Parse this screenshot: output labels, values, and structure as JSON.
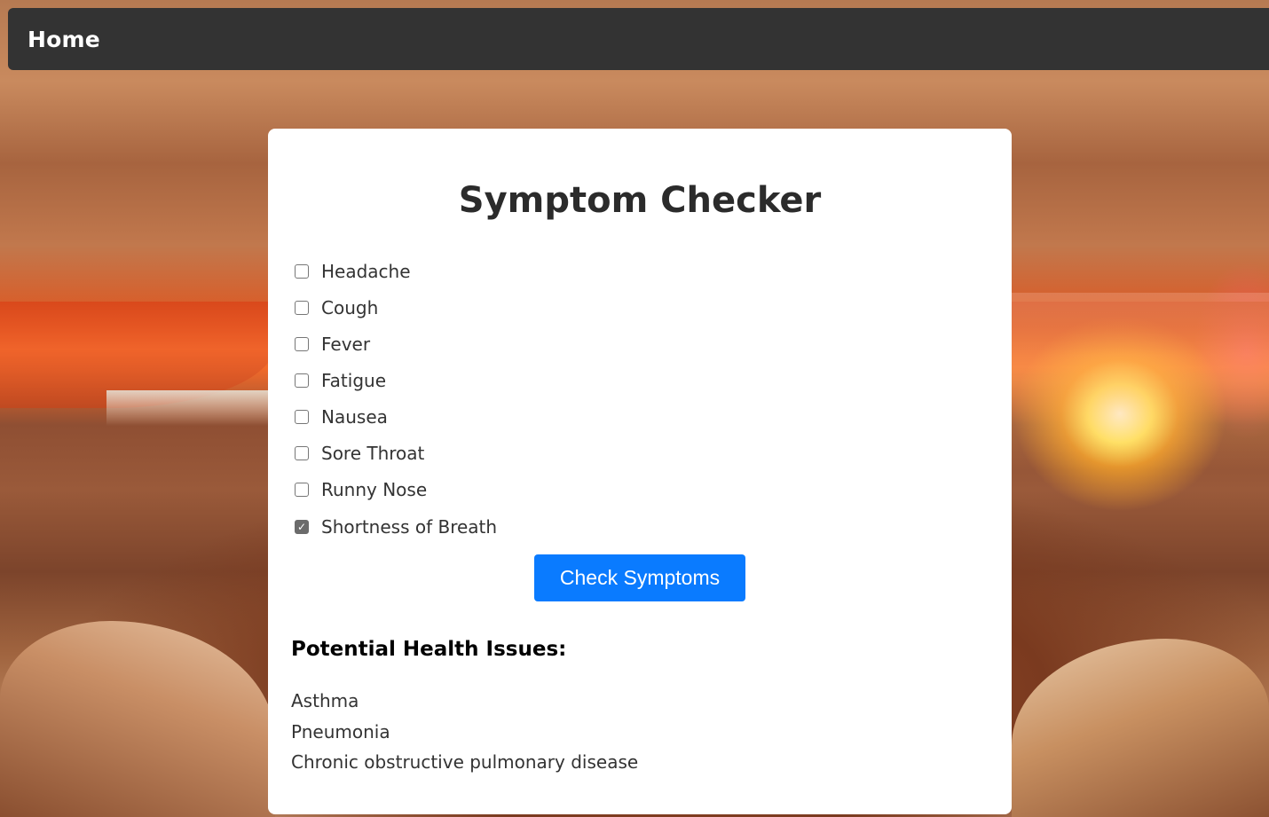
{
  "nav": {
    "home_label": "Home"
  },
  "checker": {
    "title": "Symptom Checker",
    "symptoms": [
      {
        "label": "Headache",
        "checked": false
      },
      {
        "label": "Cough",
        "checked": false
      },
      {
        "label": "Fever",
        "checked": false
      },
      {
        "label": "Fatigue",
        "checked": false
      },
      {
        "label": "Nausea",
        "checked": false
      },
      {
        "label": "Sore Throat",
        "checked": false
      },
      {
        "label": "Runny Nose",
        "checked": false
      },
      {
        "label": "Shortness of Breath",
        "checked": true
      }
    ],
    "button_label": "Check Symptoms"
  },
  "results": {
    "heading": "Potential Health Issues:",
    "items": [
      "Asthma",
      "Pneumonia",
      "Chronic obstructive pulmonary disease"
    ]
  },
  "colors": {
    "topbar": "#333333",
    "button": "#0a7bff",
    "card": "#ffffff"
  }
}
